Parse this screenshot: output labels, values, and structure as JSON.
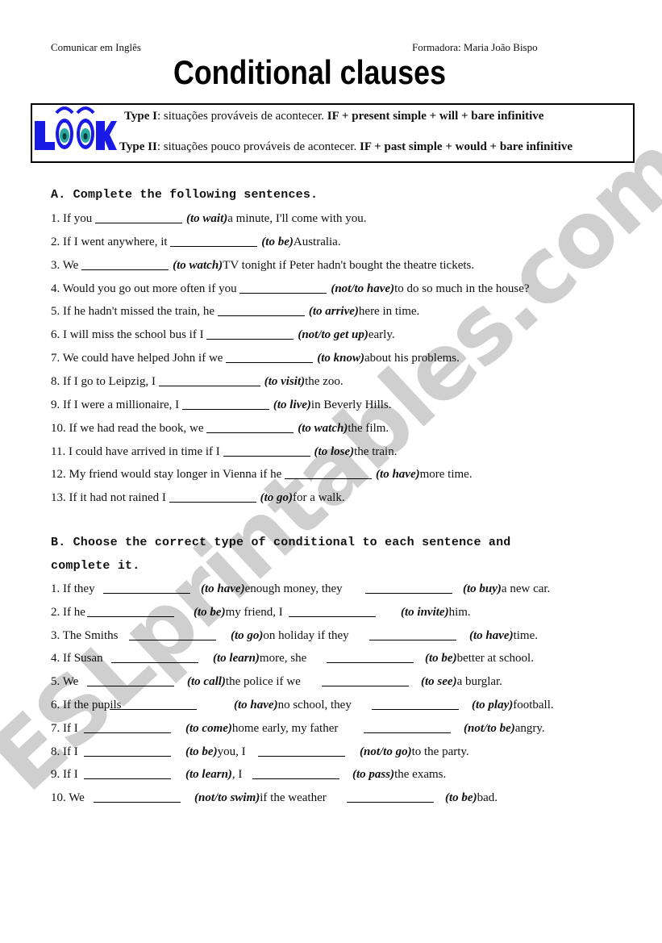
{
  "header": {
    "course": "Comunicar em Inglês",
    "trainer": "Formadora: Maria João Bispo",
    "title": "Conditional clauses"
  },
  "look_box": {
    "logo_text": "LOOK",
    "type1": {
      "label": "Type I",
      "desc": ": situações prováveis de acontecer. ",
      "formula": "IF + present simple + will + bare infinitive"
    },
    "type2": {
      "label": "Type II",
      "desc": ": situações pouco prováveis de acontecer. ",
      "formula": "IF + past simple + would + bare infinitive"
    }
  },
  "watermark": "ESLprintables.com",
  "section_a": {
    "title": "A. Complete the following sentences.",
    "items": [
      [
        "1. If you ",
        "_",
        "(to wait)",
        " a minute, I'll come with you."
      ],
      [
        "2. If I went anywhere, it ",
        "_",
        "(to be)",
        " Australia."
      ],
      [
        "3. We ",
        "_",
        "(to watch)",
        " TV tonight if Peter hadn't bought the theatre tickets."
      ],
      [
        "4. Would you go out more often if you ",
        "_",
        "(not/to have)",
        " to do so much in the house?"
      ],
      [
        "5. If he hadn't missed the train, he ",
        "_",
        "(to arrive)",
        " here in time."
      ],
      [
        "6. I will miss the school bus if I ",
        "_",
        "(not/to get up)",
        " early."
      ],
      [
        "7. We could have helped John if we ",
        "_",
        "(to know)",
        " about his problems."
      ],
      [
        "8. If I go to Leipzig, I ",
        "_",
        "(to visit)",
        " the zoo."
      ],
      [
        "9. If I were a millionaire, I ",
        "_",
        "(to live)",
        " in Beverly Hills."
      ],
      [
        "10. If we had read the book, we ",
        "_",
        "(to watch)",
        " the film."
      ],
      [
        "11. I could have arrived in time if I ",
        "_",
        "(to lose)",
        " the train."
      ],
      [
        "12. My friend would stay longer in Vienna if he ",
        "_",
        "(to have)",
        " more time."
      ],
      [
        "13. If it had not rained I ",
        "_",
        "(to go)",
        " for a walk."
      ]
    ]
  },
  "section_b": {
    "title_line1": "B. Choose the correct type of conditional to each sentence and",
    "title_line2": "complete it.",
    "items": [
      [
        "1. If they ",
        "_",
        "(to have)",
        " enough money, they ",
        "_",
        "(to buy)",
        " a new car."
      ],
      [
        "2. If he ",
        "_",
        "(to be)",
        " my friend, I ",
        "_",
        "(to invite)",
        " him."
      ],
      [
        "3. The Smiths ",
        "_",
        "(to go)",
        " on holiday if they ",
        "_",
        "(to have)",
        " time."
      ],
      [
        "4. If Susan ",
        "_",
        "(to learn)",
        " more, she ",
        "_",
        "(to be)",
        " better at school."
      ],
      [
        "5. We ",
        "_",
        "(to call)",
        " the police if we ",
        "_",
        "(to see)",
        " a burglar."
      ],
      [
        "6. If the pupils ",
        "_",
        "(to have)",
        " no school, they ",
        "_",
        "(to play)",
        " football."
      ],
      [
        "7. If I ",
        "_",
        "(to come)",
        " home early, my father ",
        "_",
        "(not/to be)",
        " angry."
      ],
      [
        "8. If I ",
        "_",
        "(to be)",
        " you, I ",
        "_",
        "(not/to go)",
        " to the party."
      ],
      [
        "9. If I ",
        "_",
        "(to learn)",
        ", I ",
        "_",
        "(to pass)",
        " the exams."
      ],
      [
        "10. We ",
        "_",
        "(not/to swim)",
        " if the weather ",
        "_",
        "(to be)",
        " bad."
      ]
    ]
  },
  "colors": {
    "logo_blue": "#1a1ae6",
    "eye_teal": "#2aa9a0",
    "watermark_gray": "#cfcfcf"
  }
}
